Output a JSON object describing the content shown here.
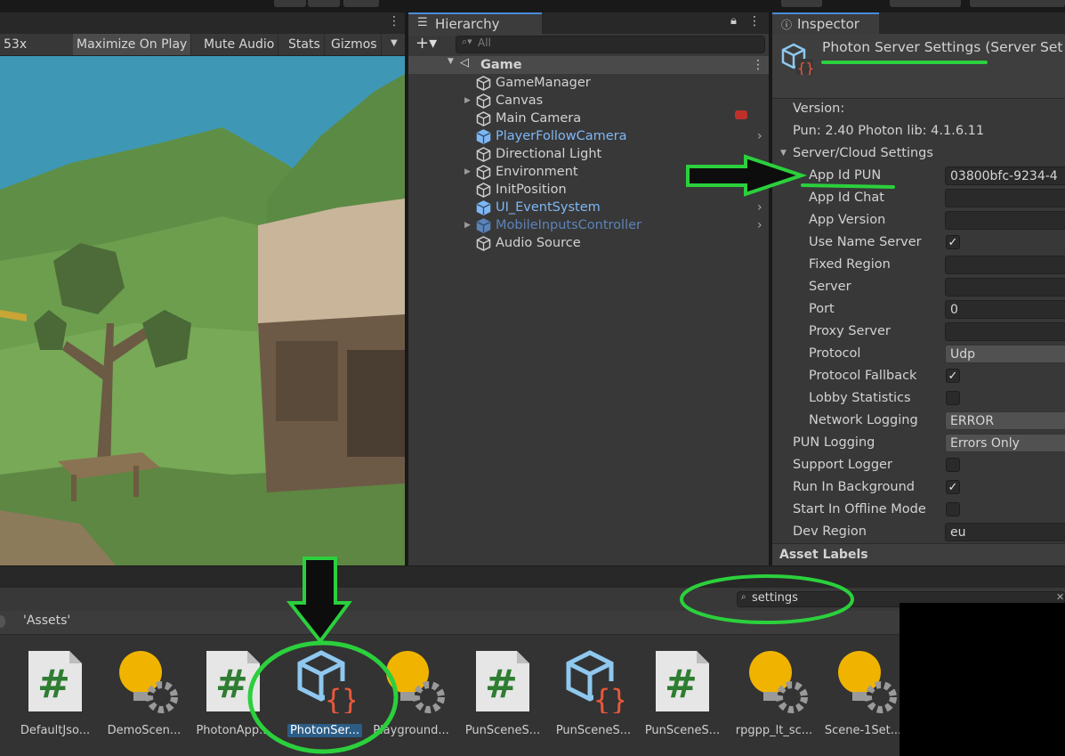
{
  "game_view": {
    "scale_label": "53x",
    "toolbar": [
      {
        "label": "Maximize On Play",
        "active": true
      },
      {
        "label": "Mute Audio",
        "active": false
      },
      {
        "label": "Stats",
        "active": false
      },
      {
        "label": "Gizmos",
        "active": false
      }
    ]
  },
  "hierarchy": {
    "tab_label": "Hierarchy",
    "search_placeholder": "All",
    "scene_name": "Game",
    "items": [
      {
        "label": "GameManager",
        "style": "normal",
        "expandable": false,
        "chevron": false
      },
      {
        "label": "Canvas",
        "style": "normal",
        "expandable": true,
        "chevron": false
      },
      {
        "label": "Main Camera",
        "style": "normal",
        "expandable": false,
        "chevron": false
      },
      {
        "label": "PlayerFollowCamera",
        "style": "prefab",
        "expandable": false,
        "chevron": true
      },
      {
        "label": "Directional Light",
        "style": "normal",
        "expandable": false,
        "chevron": false
      },
      {
        "label": "Environment",
        "style": "normal",
        "expandable": true,
        "chevron": false
      },
      {
        "label": "InitPosition",
        "style": "normal",
        "expandable": false,
        "chevron": false
      },
      {
        "label": "UI_EventSystem",
        "style": "prefab",
        "expandable": false,
        "chevron": true
      },
      {
        "label": "MobileInputsController",
        "style": "prefab-inactive",
        "expandable": true,
        "chevron": true
      },
      {
        "label": "Audio Source",
        "style": "normal",
        "expandable": false,
        "chevron": false
      }
    ]
  },
  "inspector": {
    "tab_label": "Inspector",
    "title": "Photon Server Settings (Server Set",
    "version_label": "Version:",
    "version_value": "Pun: 2.40 Photon lib: 4.1.6.11",
    "section_label": "Server/Cloud Settings",
    "section_props": [
      {
        "label": "App Id PUN",
        "kind": "text",
        "value": "03800bfc-9234-4"
      },
      {
        "label": "App Id Chat",
        "kind": "text",
        "value": ""
      },
      {
        "label": "App Version",
        "kind": "text",
        "value": ""
      },
      {
        "label": "Use Name Server",
        "kind": "check",
        "value": "✓"
      },
      {
        "label": "Fixed Region",
        "kind": "text",
        "value": ""
      },
      {
        "label": "Server",
        "kind": "text",
        "value": ""
      },
      {
        "label": "Port",
        "kind": "text",
        "value": "0"
      },
      {
        "label": "Proxy Server",
        "kind": "text",
        "value": ""
      },
      {
        "label": "Protocol",
        "kind": "dropdown",
        "value": "Udp"
      },
      {
        "label": "Protocol Fallback",
        "kind": "check",
        "value": "✓"
      },
      {
        "label": "Lobby Statistics",
        "kind": "check",
        "value": ""
      },
      {
        "label": "Network Logging",
        "kind": "dropdown",
        "value": "ERROR"
      }
    ],
    "root_props": [
      {
        "label": "PUN Logging",
        "kind": "dropdown",
        "value": "Errors Only"
      },
      {
        "label": "Support Logger",
        "kind": "check",
        "value": ""
      },
      {
        "label": "Run In Background",
        "kind": "check",
        "value": "✓"
      },
      {
        "label": "Start In Offline Mode",
        "kind": "check",
        "value": ""
      },
      {
        "label": "Dev Region",
        "kind": "text",
        "value": "eu"
      }
    ],
    "asset_labels": "Asset Labels"
  },
  "project": {
    "search_value": "settings",
    "breadcrumb": "'Assets'",
    "assets": [
      {
        "label": "DefaultJso...",
        "icon": "cs-script-icon",
        "selected": false
      },
      {
        "label": "DemoScen...",
        "icon": "lighting-settings-icon",
        "selected": false
      },
      {
        "label": "PhotonApp...",
        "icon": "cs-script-icon",
        "selected": false
      },
      {
        "label": "PhotonSer...",
        "icon": "scriptable-object-icon",
        "selected": true
      },
      {
        "label": "Playground...",
        "icon": "lighting-settings-icon",
        "selected": false
      },
      {
        "label": "PunSceneS...",
        "icon": "cs-script-icon",
        "selected": false
      },
      {
        "label": "PunSceneS...",
        "icon": "scriptable-object-icon",
        "selected": false
      },
      {
        "label": "PunSceneS...",
        "icon": "cs-script-icon",
        "selected": false
      },
      {
        "label": "rpgpp_lt_sc...",
        "icon": "lighting-settings-icon",
        "selected": false
      },
      {
        "label": "Scene-1Set...",
        "icon": "lighting-settings-icon",
        "selected": false
      }
    ]
  },
  "colors": {
    "annotation_green": "#2bd03c",
    "prefab_blue": "#7fb7f5",
    "selection_blue": "#2c5d87",
    "panel_bg": "#383838"
  }
}
